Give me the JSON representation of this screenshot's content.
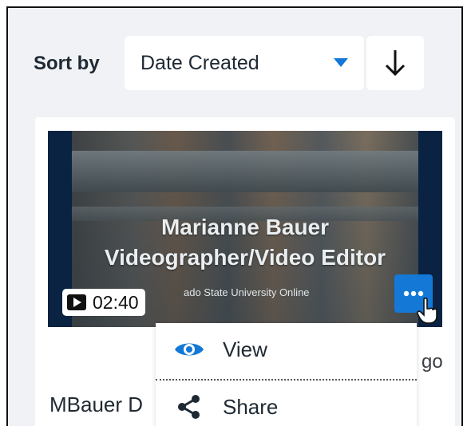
{
  "sort": {
    "label": "Sort by",
    "selected": "Date Created"
  },
  "video": {
    "title_line1": "Marianne Bauer",
    "title_line2": "Videographer/Video Editor",
    "subtitle": "ado State University Online",
    "duration": "02:40",
    "name": "MBauer D",
    "ago_fragment": "go"
  },
  "menu": {
    "items": [
      {
        "label": "View"
      },
      {
        "label": "Share"
      }
    ]
  },
  "colors": {
    "accent": "#1479d6",
    "background": "#f0f2f5",
    "card": "#ffffff"
  }
}
